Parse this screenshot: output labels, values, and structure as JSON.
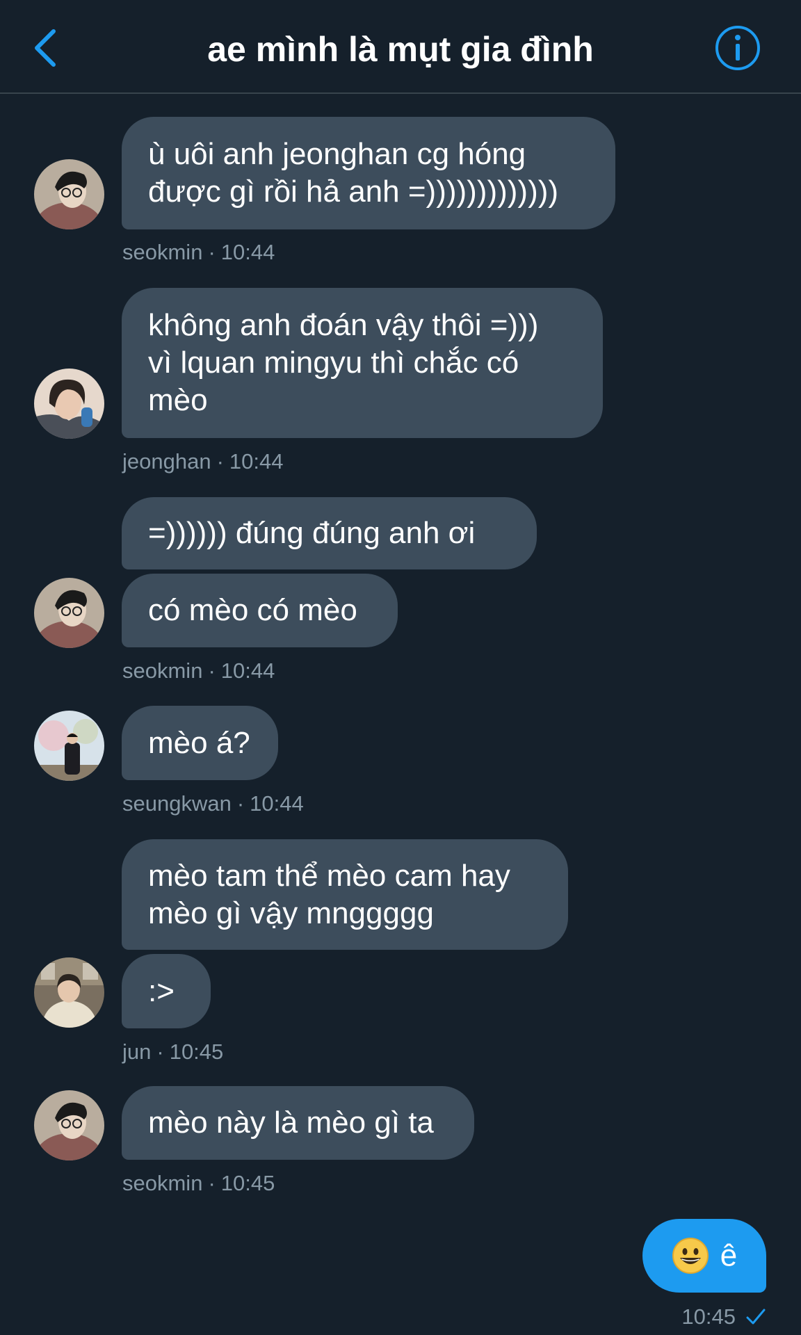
{
  "header": {
    "title": "ae mình là mụt gia đình",
    "back_icon": "chevron-left-icon",
    "info_icon": "info-icon",
    "accent_color": "#1d9bf0"
  },
  "messages": [
    {
      "sender": "seokmin",
      "time": "10:44",
      "bubbles": [
        "ù uôi anh jeonghan cg hóng\nđược gì rồi hả anh =)))))))))))))"
      ]
    },
    {
      "sender": "jeonghan",
      "time": "10:44",
      "bubbles": [
        "không anh đoán vậy thôi =)))\nvì lquan mingyu thì chắc có\nmèo"
      ]
    },
    {
      "sender": "seokmin",
      "time": "10:44",
      "bubbles": [
        "=)))))) đúng đúng anh ơi",
        "có mèo có mèo"
      ]
    },
    {
      "sender": "seungkwan",
      "time": "10:44",
      "bubbles": [
        "mèo á?"
      ]
    },
    {
      "sender": "jun",
      "time": "10:45",
      "bubbles": [
        "mèo tam thể mèo cam hay\nmèo gì vậy mnggggg",
        ":>"
      ]
    },
    {
      "sender": "seokmin",
      "time": "10:45",
      "bubbles": [
        "mèo này là mèo gì ta"
      ]
    }
  ],
  "my_message": {
    "emoji": "grinning-face-emoji",
    "text": "ê",
    "time": "10:45",
    "status_icon": "checkmark-icon"
  },
  "separator": "·"
}
